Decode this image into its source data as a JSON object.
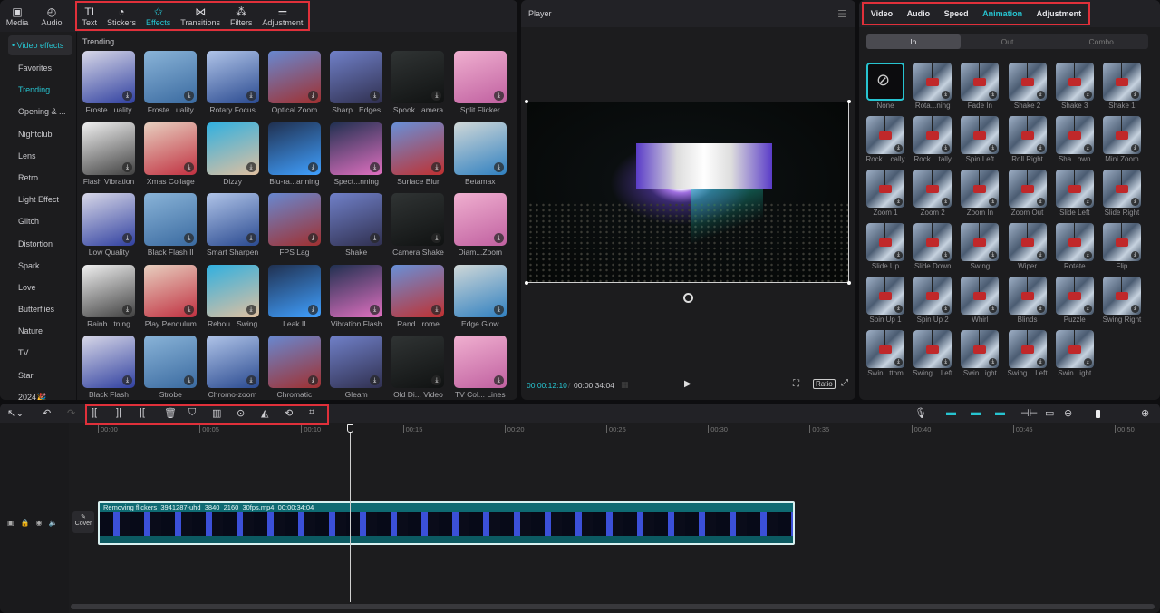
{
  "top_toolbar": {
    "items": [
      {
        "label": "Media",
        "icon": "media-icon"
      },
      {
        "label": "Audio",
        "icon": "audio-icon"
      },
      {
        "label": "Text",
        "icon": "text-icon"
      },
      {
        "label": "Stickers",
        "icon": "sticker-icon"
      },
      {
        "label": "Effects",
        "icon": "effects-icon",
        "active": true
      },
      {
        "label": "Transitions",
        "icon": "transition-icon"
      },
      {
        "label": "Filters",
        "icon": "filter-icon"
      },
      {
        "label": "Adjustment",
        "icon": "adjustment-icon"
      }
    ]
  },
  "sidebar": {
    "header": "• Video effects",
    "items": [
      "Favorites",
      "Trending",
      "Opening & ...",
      "Nightclub",
      "Lens",
      "Retro",
      "Light Effect",
      "Glitch",
      "Distortion",
      "Spark",
      "Love",
      "Butterflies",
      "Nature",
      "TV",
      "Star",
      "2024🎉"
    ],
    "active": "Trending"
  },
  "effects": {
    "section_title": "Trending",
    "items": [
      "Froste...uality",
      "Froste...uality",
      "Rotary Focus",
      "Optical Zoom",
      "Sharp...Edges",
      "Spook...amera",
      "Split Flicker",
      "Flash Vibration",
      "Xmas Collage",
      "Dizzy",
      "Blu-ra...anning",
      "Spect...nning",
      "Surface Blur",
      "Betamax",
      "Low Quality",
      "Black Flash II",
      "Smart Sharpen",
      "FPS Lag",
      "Shake",
      "Camera Shake",
      "Diam...Zoom",
      "Rainb...tning",
      "Play Pendulum",
      "Rebou...Swing",
      "Leak II",
      "Vibration Flash",
      "Rand...rome",
      "Edge Glow",
      "Black Flash",
      "Strobe",
      "Chromo-zoom",
      "Chromatic",
      "Gleam",
      "Old Di... Video",
      "TV Col... Lines"
    ]
  },
  "player": {
    "title": "Player",
    "current_time": "00:00:12:10",
    "separator": "/",
    "total_time": "00:00:34:04",
    "ratio_label": "Ratio"
  },
  "inspector": {
    "tabs": [
      "Video",
      "Audio",
      "Speed",
      "Animation",
      "Adjustment"
    ],
    "active_tab": "Animation",
    "segments": [
      "In",
      "Out",
      "Combo"
    ],
    "active_segment": "In",
    "animations": [
      "None",
      "Rota...ning",
      "Fade In",
      "Shake 2",
      "Shake 3",
      "Shake 1",
      "Rock ...cally",
      "Rock ...tally",
      "Spin Left",
      "Roll Right",
      "Sha...own",
      "Mini Zoom",
      "Zoom 1",
      "Zoom 2",
      "Zoom In",
      "Zoom Out",
      "Slide Left",
      "Slide Right",
      "Slide Up",
      "Slide Down",
      "Swing",
      "Wiper",
      "Rotate",
      "Flip",
      "Spin Up 1",
      "Spin Up 2",
      "Whirl",
      "Blinds",
      "Puzzle",
      "Swing Right",
      "Swin...ttom",
      "Swing... Left",
      "Swin...ight",
      "Swing... Left",
      "Swin...ight"
    ],
    "selected_animation": "None"
  },
  "timeline": {
    "ruler": [
      "00:00",
      "00:05",
      "00:10",
      "00:15",
      "00:20",
      "00:25",
      "00:30",
      "00:35",
      "00:40",
      "00:45",
      "00:50"
    ],
    "clip": {
      "title": "Removing flickers",
      "file": "3941287-uhd_3840_2160_30fps.mp4",
      "duration": "00:00:34:04"
    },
    "cover_label": "Cover",
    "zoom_level": 0.35,
    "edit_tools": [
      "split-icon",
      "split-left-icon",
      "split-right-icon",
      "delete-icon",
      "marker-icon",
      "freeze-icon",
      "reverse-icon",
      "mirror-icon",
      "rotate-icon",
      "crop-icon"
    ]
  }
}
